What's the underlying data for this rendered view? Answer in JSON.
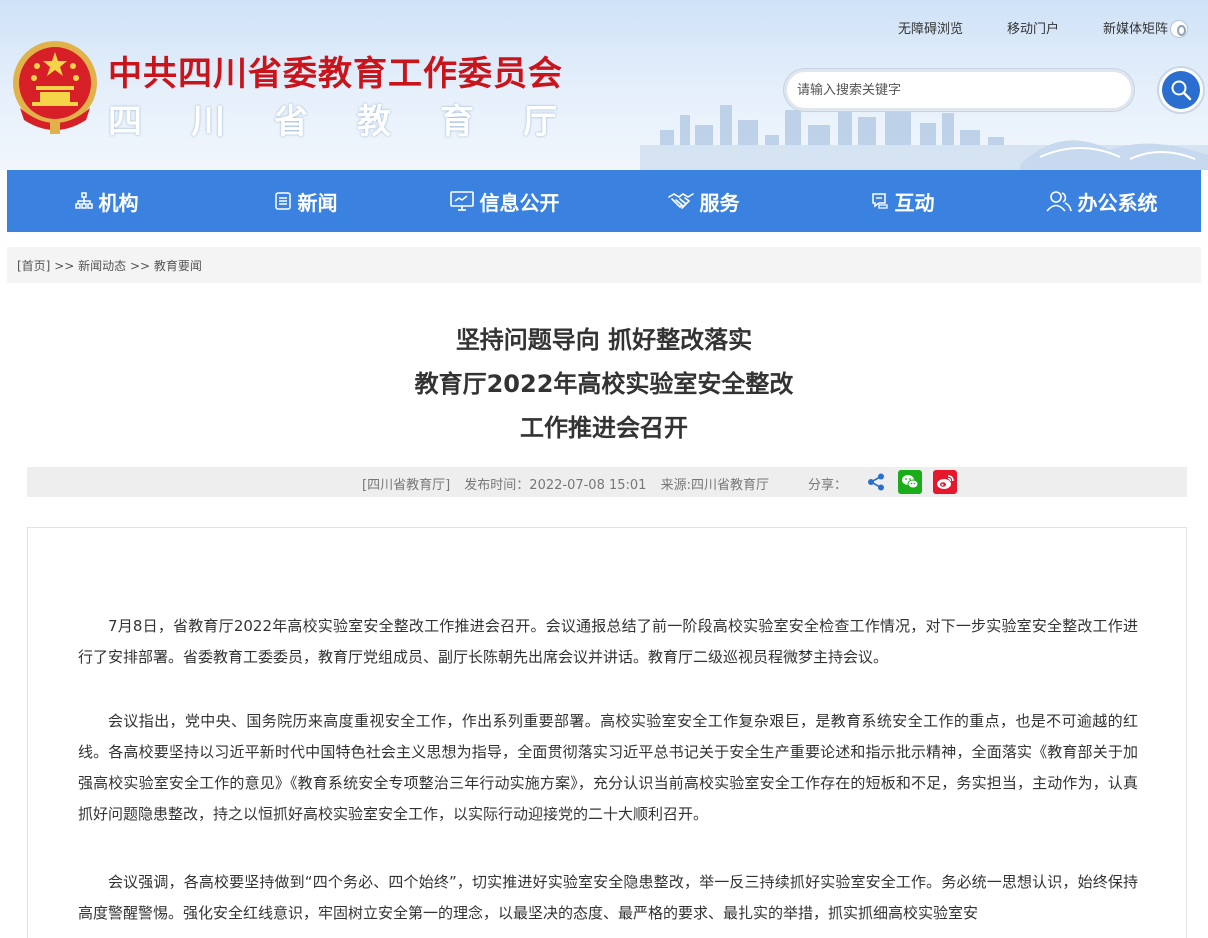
{
  "header": {
    "org_title": "中共四川省委教育工作委员会",
    "org_subtitle": "四川省教育厅",
    "top_links": [
      "无障碍浏览",
      "移动门户",
      "新媒体矩阵"
    ],
    "search_placeholder": "请输入搜索关键字"
  },
  "nav": {
    "items": [
      {
        "label": "机构",
        "icon": "org-chart-icon"
      },
      {
        "label": "新闻",
        "icon": "news-icon"
      },
      {
        "label": "信息公开",
        "icon": "monitor-icon"
      },
      {
        "label": "服务",
        "icon": "handshake-icon"
      },
      {
        "label": "互动",
        "icon": "chat-icon"
      },
      {
        "label": "办公系统",
        "icon": "users-icon"
      }
    ]
  },
  "breadcrumb": {
    "home": "[首页]",
    "sep": ">>",
    "level1": "新闻动态",
    "level2": "教育要闻"
  },
  "article": {
    "title_lines": [
      "坚持问题导向 抓好整改落实",
      "教育厅2022年高校实验室安全整改",
      "工作推进会召开"
    ],
    "meta": {
      "source_tag": "[四川省教育厅]",
      "publish_time": "发布时间：2022-07-08 15:01",
      "source": "来源:四川省教育厅",
      "share_label": "分享："
    },
    "paragraphs": [
      "7月8日，省教育厅2022年高校实验室安全整改工作推进会召开。会议通报总结了前一阶段高校实验室安全检查工作情况，对下一步实验室安全整改工作进行了安排部署。省委教育工委委员，教育厅党组成员、副厅长陈朝先出席会议并讲话。教育厅二级巡视员程微梦主持会议。",
      "会议指出，党中央、国务院历来高度重视安全工作，作出系列重要部署。高校实验室安全工作复杂艰巨，是教育系统安全工作的重点，也是不可逾越的红线。各高校要坚持以习近平新时代中国特色社会主义思想为指导，全面贯彻落实习近平总书记关于安全生产重要论述和指示批示精神，全面落实《教育部关于加强高校实验室安全工作的意见》《教育系统安全专项整治三年行动实施方案》，充分认识当前高校实验室安全工作存在的短板和不足，务实担当，主动作为，认真抓好问题隐患整改，持之以恒抓好高校实验室安全工作，以实际行动迎接党的二十大顺利召开。",
      "会议强调，各高校要坚持做到“四个务必、四个始终”，切实推进好实验室安全隐患整改，举一反三持续抓好实验室安全工作。务必统一思想认识，始终保持高度警醒警惕。强化安全红线意识，牢固树立安全第一的理念，以最坚决的态度、最严格的要求、最扎实的举措，抓实抓细高校实验室安"
    ]
  },
  "colors": {
    "title_red": "#c9141b",
    "nav_blue": "#3b82e0",
    "wechat_green": "#1aad19",
    "weibo_red": "#e6162d"
  }
}
